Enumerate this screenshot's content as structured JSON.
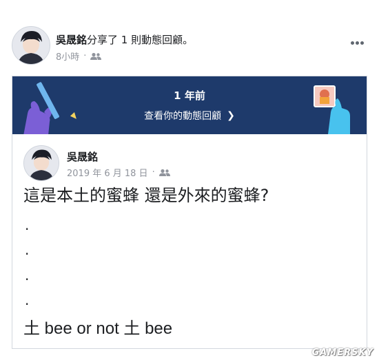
{
  "post": {
    "author": "吳晟銘",
    "action": "分享了 1 則動態回顧。",
    "time": "8小時",
    "separator": "·",
    "audience_icon": "people-icon",
    "more_icon": "more-icon"
  },
  "memory": {
    "title": "1 年前",
    "link_text": "查看你的動態回顧",
    "link_arrow": "❯"
  },
  "shared_post": {
    "author": "吳晟銘",
    "date": "2019 年 6 月 18 日",
    "separator": "·",
    "lines": [
      "這是本土的蜜蜂 還是外來的蜜蜂?",
      ".",
      ".",
      ".",
      ".",
      "土 bee or not 土 bee"
    ]
  },
  "watermark": "GAMERSKY",
  "colors": {
    "banner_bg": "#1e3a6b",
    "meta_gray": "#90949c",
    "text": "#1c1e21"
  }
}
